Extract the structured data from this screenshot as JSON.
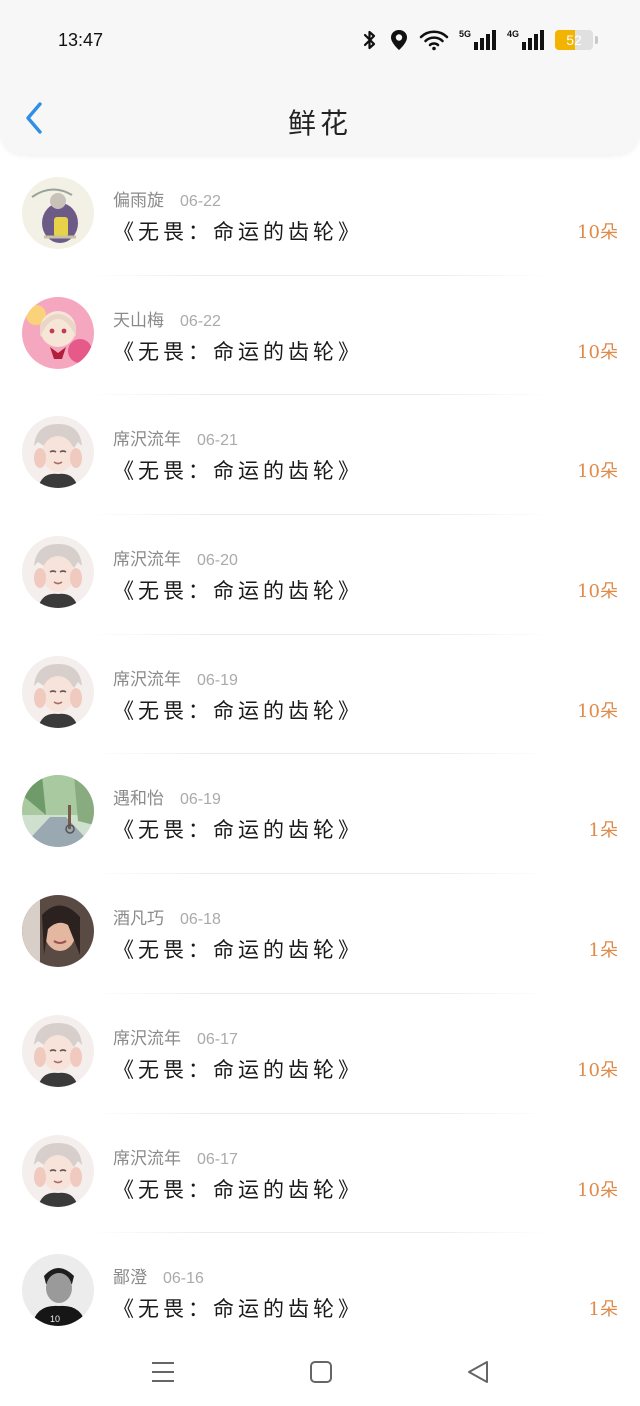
{
  "status_bar": {
    "time": "13:47",
    "network_5g": "5G",
    "network_4g": "4G",
    "battery_level": "52",
    "battery_color": "#f2b400"
  },
  "header": {
    "title": "鲜花",
    "back_icon": "chevron-left-icon",
    "accent_color": "#2f8fe6"
  },
  "records": [
    {
      "name": "偏雨旋",
      "date": "06-22",
      "gift": "《无畏：命运的齿轮》",
      "count": "10朵",
      "avatar": "avatar-girl-backpack"
    },
    {
      "name": "天山梅",
      "date": "06-22",
      "gift": "《无畏：命运的齿轮》",
      "count": "10朵",
      "avatar": "avatar-anime-girl-pink"
    },
    {
      "name": "席沢流年",
      "date": "06-21",
      "gift": "《无畏：命运的齿轮》",
      "count": "10朵",
      "avatar": "avatar-anime-boy"
    },
    {
      "name": "席沢流年",
      "date": "06-20",
      "gift": "《无畏：命运的齿轮》",
      "count": "10朵",
      "avatar": "avatar-anime-boy"
    },
    {
      "name": "席沢流年",
      "date": "06-19",
      "gift": "《无畏：命运的齿轮》",
      "count": "10朵",
      "avatar": "avatar-anime-boy"
    },
    {
      "name": "遇和怡",
      "date": "06-19",
      "gift": "《无畏：命运的齿轮》",
      "count": "1朵",
      "avatar": "avatar-street-scene"
    },
    {
      "name": "酒凡巧",
      "date": "06-18",
      "gift": "《无畏：命运的齿轮》",
      "count": "1朵",
      "avatar": "avatar-woman-photo"
    },
    {
      "name": "席沢流年",
      "date": "06-17",
      "gift": "《无畏：命运的齿轮》",
      "count": "10朵",
      "avatar": "avatar-anime-boy"
    },
    {
      "name": "席沢流年",
      "date": "06-17",
      "gift": "《无畏：命运的齿轮》",
      "count": "10朵",
      "avatar": "avatar-anime-boy"
    },
    {
      "name": "鄙澄",
      "date": "06-16",
      "gift": "《无畏：命运的齿轮》",
      "count": "1朵",
      "avatar": "avatar-man-bw"
    }
  ],
  "colors": {
    "count_color": "#e08a4a",
    "name_color": "#8a8a8a"
  },
  "nav_bar": {
    "menu_icon": "menu-icon",
    "home_icon": "home-square-icon",
    "back_icon": "back-triangle-icon"
  }
}
